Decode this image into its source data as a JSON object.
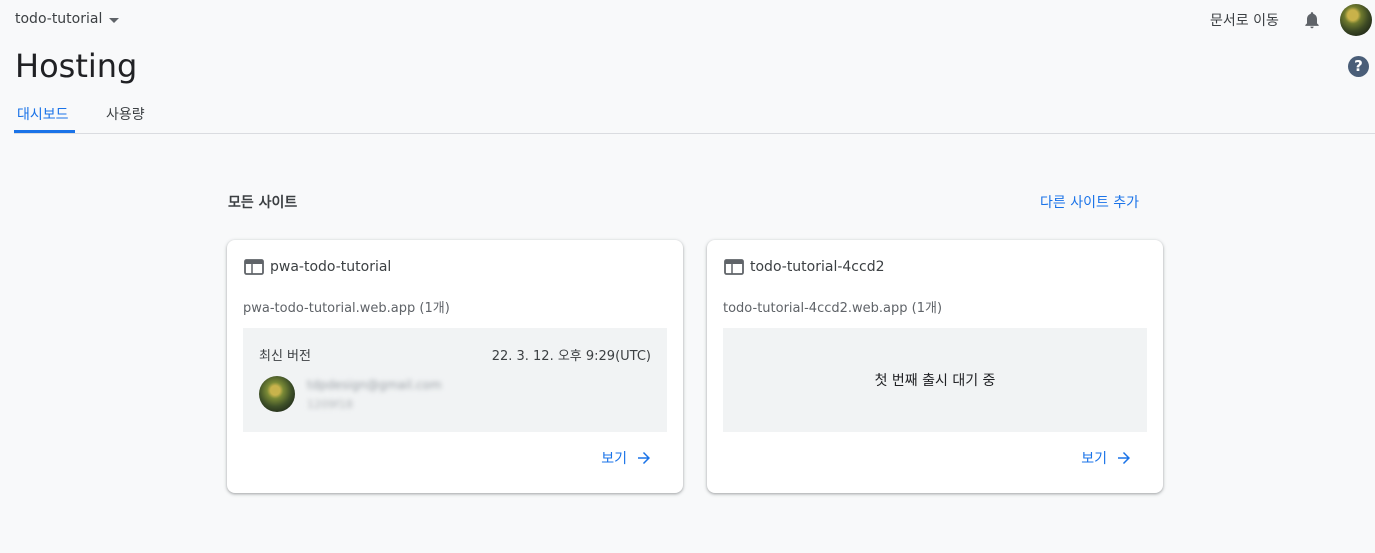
{
  "topbar": {
    "project_name": "todo-tutorial",
    "docs_link": "문서로 이동"
  },
  "page": {
    "title": "Hosting",
    "help_glyph": "?"
  },
  "tabs": [
    {
      "label": "대시보드",
      "active": true
    },
    {
      "label": "사용량",
      "active": false
    }
  ],
  "section": {
    "title": "모든 사이트",
    "add_site": "다른 사이트 추가"
  },
  "sites": [
    {
      "name": "pwa-todo-tutorial",
      "url": "pwa-todo-tutorial.web.app",
      "count": "(1개)",
      "latest_label": "최신 버전",
      "latest_date": "22. 3. 12. 오후 9:29(UTC)",
      "deployer_email": "tdpdesign@gmail.com",
      "deployer_id": "1209f18",
      "view_label": "보기"
    },
    {
      "name": "todo-tutorial-4ccd2",
      "url": "todo-tutorial-4ccd2.web.app",
      "count": "(1개)",
      "waiting_text": "첫 번째 출시 대기 중",
      "view_label": "보기"
    }
  ],
  "colors": {
    "accent": "#1a73e8",
    "background": "#f8f9fa",
    "panel": "#f1f3f4"
  },
  "icons": [
    "chevron-down-icon",
    "bell-icon",
    "help-icon",
    "web-site-icon",
    "arrow-right-icon"
  ]
}
